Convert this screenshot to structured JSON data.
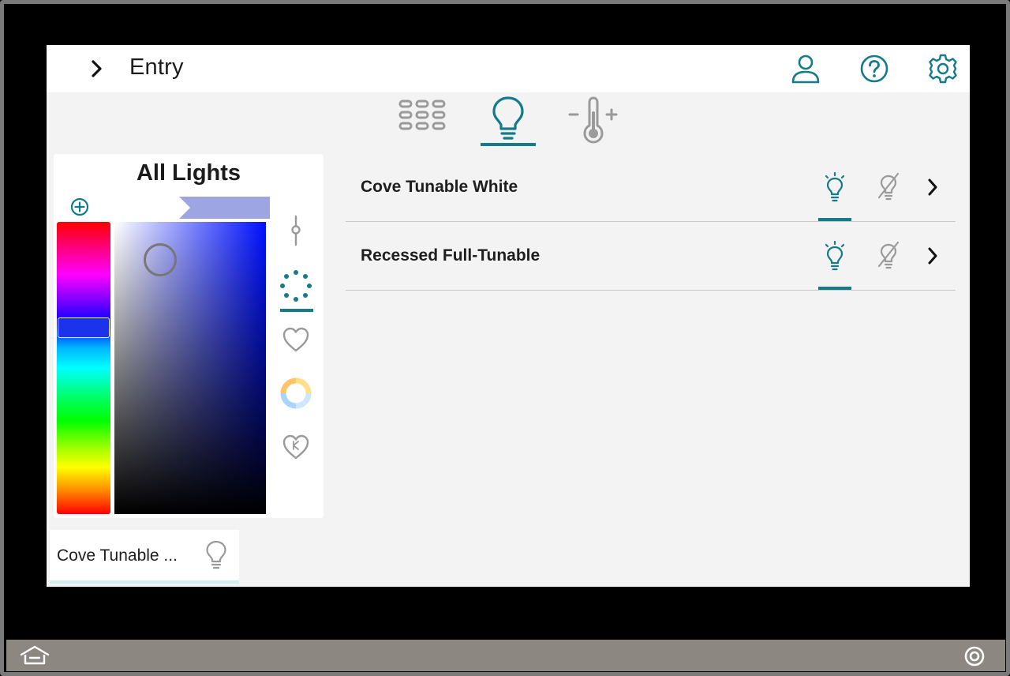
{
  "header": {
    "title": "Entry",
    "icons": [
      "chevron-right-icon",
      "user-icon",
      "help-icon",
      "gear-icon"
    ]
  },
  "tabs": [
    {
      "icon": "keypad-icon",
      "selected": false
    },
    {
      "icon": "lightbulb-icon",
      "selected": true
    },
    {
      "icon": "thermostat-icon",
      "selected": false
    }
  ],
  "color_panel": {
    "title": "All Lights",
    "selected_color": "#9da6e3",
    "modes": [
      {
        "icon": "slider-icon",
        "selected": false
      },
      {
        "icon": "color-wheel-dots-icon",
        "selected": true
      },
      {
        "icon": "heart-icon",
        "selected": false
      },
      {
        "icon": "color-temperature-ring-icon",
        "selected": false
      },
      {
        "icon": "heart-kelvin-icon",
        "selected": false
      }
    ]
  },
  "fixtures": [
    {
      "name": "Cove Tunable White",
      "on_icon": "lightbulb-on-icon",
      "off_icon": "lightbulb-off-icon",
      "state": "on"
    },
    {
      "name": "Recessed Full-Tunable",
      "on_icon": "lightbulb-on-icon",
      "off_icon": "lightbulb-off-icon",
      "state": "on"
    }
  ],
  "chip": {
    "label": "Cove Tunable ...",
    "icon": "lightbulb-outline-icon"
  },
  "colors": {
    "accent": "#157a8a",
    "background": "#f4f3f3",
    "taskbar": "#8c8780"
  }
}
